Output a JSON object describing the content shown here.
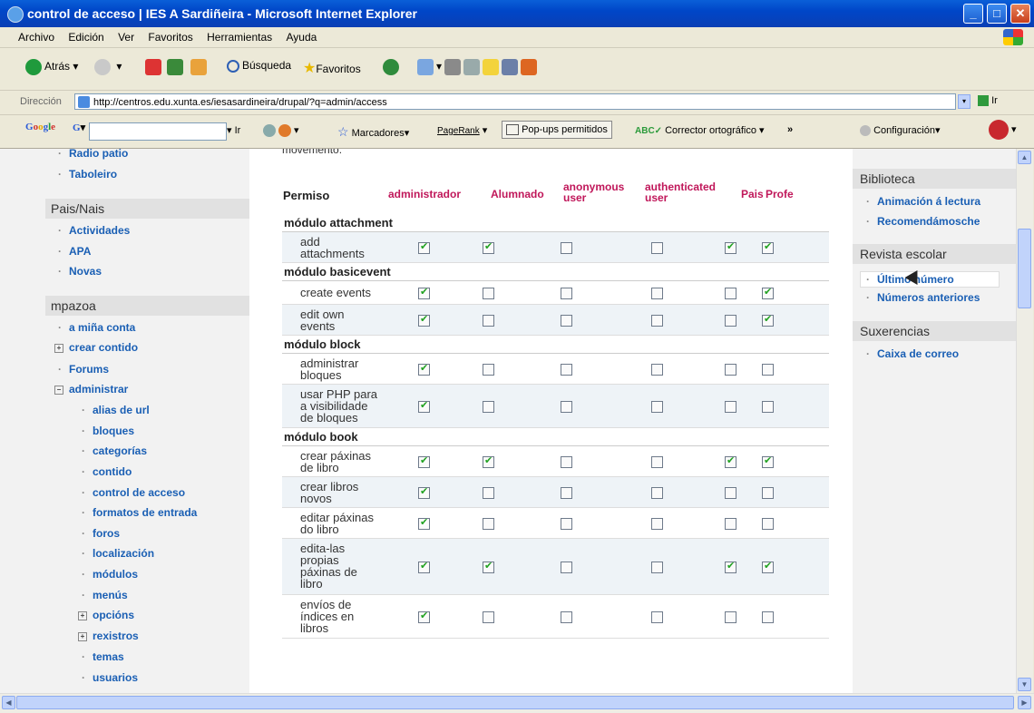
{
  "window": {
    "title": "control de acceso | IES A Sardiñeira - Microsoft Internet Explorer"
  },
  "menu": [
    "Archivo",
    "Edición",
    "Ver",
    "Favoritos",
    "Herramientas",
    "Ayuda"
  ],
  "toolbar": {
    "back": "Atrás",
    "search": "Búsqueda",
    "favorites": "Favoritos"
  },
  "address": {
    "label": "Dirección",
    "url": "http://centros.edu.xunta.es/iesasardineira/drupal/?q=admin/access",
    "go": "Ir"
  },
  "googlebar": {
    "go": "Ir",
    "bookmarks": "Marcadores",
    "pagerank": "PageRank",
    "popups": "Pop-ups permitidos",
    "spell": "Corrector ortográfico",
    "more": "»",
    "settings": "Configuración"
  },
  "left": {
    "top_items": [
      "Radio patio",
      "Taboleiro"
    ],
    "section1": "Pais/Nais",
    "section1_items": [
      "Actividades",
      "APA",
      "Novas"
    ],
    "section2": "mpazoa",
    "section2_items": [
      "a miña conta",
      "crear contido",
      "Forums",
      "administrar"
    ],
    "admin_items": [
      "alias de url",
      "bloques",
      "categorías",
      "contido",
      "control de acceso",
      "formatos de entrada",
      "foros",
      "localización",
      "módulos",
      "menús",
      "opcións",
      "rexistros",
      "temas",
      "usuarios"
    ]
  },
  "main": {
    "intro": "movemento.",
    "header": {
      "perm": "Permiso",
      "roles": [
        "administrador",
        "Alumnado",
        "anonymous user",
        "authenticated user",
        "Pais",
        "Profe"
      ]
    },
    "groups": [
      {
        "name": "módulo attachment",
        "rows": [
          {
            "label": "add attachments",
            "checks": [
              1,
              1,
              0,
              0,
              1,
              1
            ]
          }
        ]
      },
      {
        "name": "módulo basicevent",
        "rows": [
          {
            "label": "create events",
            "checks": [
              1,
              0,
              0,
              0,
              0,
              1
            ]
          },
          {
            "label": "edit own events",
            "checks": [
              1,
              0,
              0,
              0,
              0,
              1
            ]
          }
        ]
      },
      {
        "name": "módulo block",
        "rows": [
          {
            "label": "administrar bloques",
            "checks": [
              1,
              0,
              0,
              0,
              0,
              0
            ]
          },
          {
            "label": "usar PHP para a visibilidade de bloques",
            "checks": [
              1,
              0,
              0,
              0,
              0,
              0
            ]
          }
        ]
      },
      {
        "name": "módulo book",
        "rows": [
          {
            "label": "crear páxinas de libro",
            "checks": [
              1,
              1,
              0,
              0,
              1,
              1
            ]
          },
          {
            "label": "crear libros novos",
            "checks": [
              1,
              0,
              0,
              0,
              0,
              0
            ]
          },
          {
            "label": "editar páxinas do libro",
            "checks": [
              1,
              0,
              0,
              0,
              0,
              0
            ]
          },
          {
            "label": "edita-las propias páxinas de libro",
            "checks": [
              1,
              1,
              0,
              0,
              1,
              1
            ]
          },
          {
            "label": "envíos de índices en libros",
            "checks": [
              1,
              0,
              0,
              0,
              0,
              0
            ]
          }
        ]
      }
    ]
  },
  "right": {
    "sections": [
      {
        "title": "Biblioteca",
        "items": [
          "Animación á lectura",
          "Recomendámosche"
        ]
      },
      {
        "title": "Revista escolar",
        "items": [
          "Último número",
          "Números anteriores"
        ]
      },
      {
        "title": "Suxerencias",
        "items": [
          "Caixa de correo"
        ]
      }
    ]
  },
  "colors": {
    "role": "#c0175a",
    "link": "#1a5fb4",
    "check": "#21a121"
  }
}
